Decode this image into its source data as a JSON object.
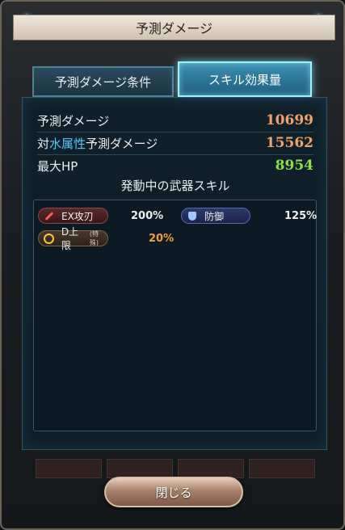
{
  "dialog": {
    "title": "予測ダメージ",
    "close_label": "閉じる"
  },
  "tabs": {
    "conditions": "予測ダメージ条件",
    "skill_effect": "スキル効果量",
    "active": "skill_effect"
  },
  "stats": [
    {
      "label": "予測ダメージ",
      "value": "10699",
      "color": "#f0a26a"
    },
    {
      "label_prefix": "対",
      "label_element": "水属性",
      "label_suffix": "予測ダメージ",
      "value": "15562",
      "color": "#f0a26a"
    },
    {
      "label": "最大HP",
      "value": "8954",
      "color": "#8be04a"
    }
  ],
  "weapon_skills": {
    "title": "発動中の武器スキル",
    "items": [
      {
        "label": "EX攻刃",
        "value": "200%",
        "icon": "sword-icon",
        "badge_color": "#5b2a2a"
      },
      {
        "label": "防御",
        "value": "125%",
        "icon": "shield-icon",
        "badge_color": "#2c3a68"
      },
      {
        "label": "D上限",
        "sublabel": "(特殊)",
        "value": "20%",
        "icon": "ring-icon",
        "badge_color": "#4a3a2a",
        "value_color": "#f0a030"
      }
    ]
  },
  "colors": {
    "water_element": "#58c8ff",
    "accent_cyan": "#9ff1ff"
  }
}
